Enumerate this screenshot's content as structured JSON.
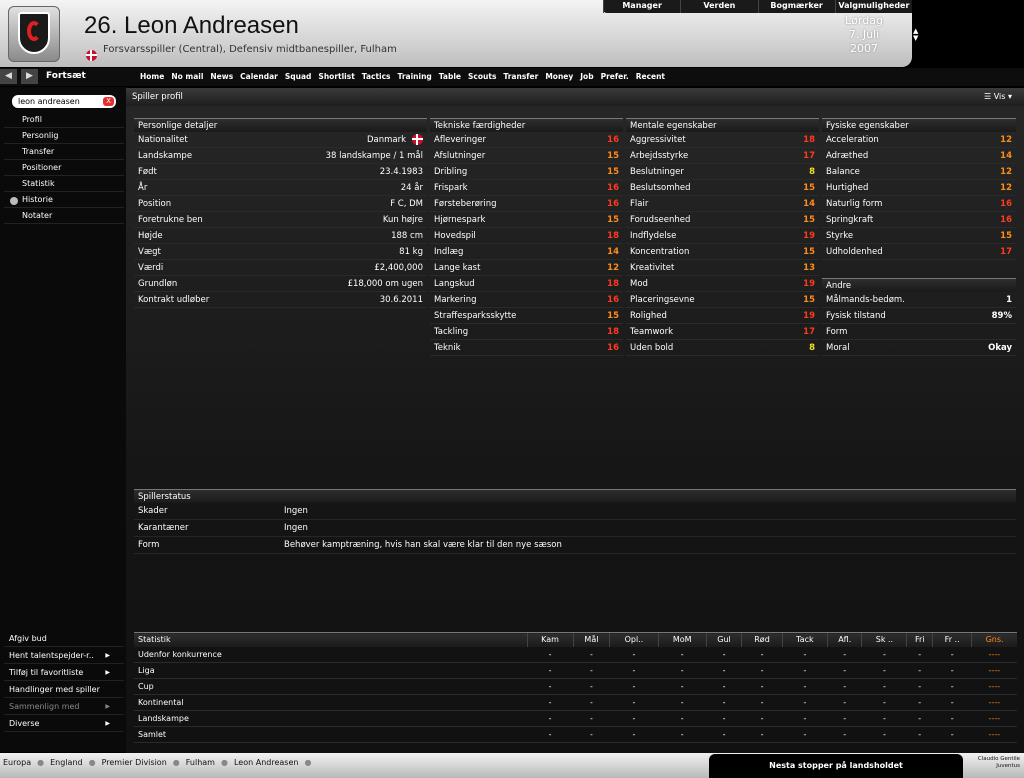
{
  "header": {
    "player_name": "26. Leon Andreasen",
    "player_role": "Forsvarsspiller (Central), Defensiv midtbanespiller, Fulham",
    "top_menu": [
      "Manager",
      "Verden",
      "Bogmærker",
      "Valgmuligheder"
    ],
    "date": {
      "weekday": "Lørdag",
      "day": "7. Juli",
      "year": "2007"
    }
  },
  "nav": {
    "back_label": "Fortsæt",
    "items": [
      "Home",
      "No mail",
      "News",
      "Calendar",
      "Squad",
      "Shortlist",
      "Tactics",
      "Training",
      "Table",
      "Scouts",
      "Transfer",
      "Money",
      "Job",
      "Prefer.",
      "Recent"
    ]
  },
  "sidebar": {
    "search_value": "leon andreasen",
    "search_clear": "X",
    "items": [
      "Profil",
      "Personlig",
      "Transfer",
      "Positioner",
      "Statistik",
      "Historie",
      "Notater"
    ],
    "actions": [
      "Afgiv bud",
      "Hent talentspejder-r..",
      "Tilføj til favoritliste",
      "Handlinger med spiller",
      "Sammenlign med",
      "Diverse"
    ]
  },
  "main": {
    "title": "Spiller profil",
    "view_label": "Vis"
  },
  "personal": {
    "title": "Personlige detaljer",
    "rows": [
      {
        "label": "Nationalitet",
        "value": "Danmark"
      },
      {
        "label": "Landskampe",
        "value": "38 landskampe / 1 mål"
      },
      {
        "label": "Født",
        "value": "23.4.1983"
      },
      {
        "label": "År",
        "value": "24 år"
      },
      {
        "label": "Position",
        "value": "F C, DM"
      },
      {
        "label": "Foretrukne ben",
        "value": "Kun højre"
      },
      {
        "label": "Højde",
        "value": "188 cm"
      },
      {
        "label": "Vægt",
        "value": "81 kg"
      },
      {
        "label": "Værdi",
        "value": "£2,400,000"
      },
      {
        "label": "Grundløn",
        "value": "£18,000 om ugen"
      },
      {
        "label": "Kontrakt udløber",
        "value": "30.6.2011"
      }
    ]
  },
  "technical": {
    "title": "Tekniske færdigheder",
    "rows": [
      {
        "label": "Afleveringer",
        "value": "16",
        "color": "#ff3b1f"
      },
      {
        "label": "Afslutninger",
        "value": "15",
        "color": "#ff8c1a"
      },
      {
        "label": "Dribling",
        "value": "15",
        "color": "#ff8c1a"
      },
      {
        "label": "Frispark",
        "value": "16",
        "color": "#ff3b1f"
      },
      {
        "label": "Førsteberøring",
        "value": "16",
        "color": "#ff3b1f"
      },
      {
        "label": "Hjørnespark",
        "value": "15",
        "color": "#ff8c1a"
      },
      {
        "label": "Hovedspil",
        "value": "18",
        "color": "#ff3b1f"
      },
      {
        "label": "Indlæg",
        "value": "14",
        "color": "#ff8c1a"
      },
      {
        "label": "Lange kast",
        "value": "12",
        "color": "#ff8c1a"
      },
      {
        "label": "Langskud",
        "value": "18",
        "color": "#ff3b1f"
      },
      {
        "label": "Markering",
        "value": "16",
        "color": "#ff3b1f"
      },
      {
        "label": "Straffesparksskytte",
        "value": "15",
        "color": "#ff8c1a"
      },
      {
        "label": "Tackling",
        "value": "18",
        "color": "#ff3b1f"
      },
      {
        "label": "Teknik",
        "value": "16",
        "color": "#ff3b1f"
      }
    ]
  },
  "mental": {
    "title": "Mentale egenskaber",
    "rows": [
      {
        "label": "Aggressivitet",
        "value": "18",
        "color": "#ff3b1f"
      },
      {
        "label": "Arbejdsstyrke",
        "value": "17",
        "color": "#ff3b1f"
      },
      {
        "label": "Beslutninger",
        "value": "8",
        "color": "#f0e020"
      },
      {
        "label": "Beslutsomhed",
        "value": "15",
        "color": "#ff8c1a"
      },
      {
        "label": "Flair",
        "value": "14",
        "color": "#ff8c1a"
      },
      {
        "label": "Forudseenhed",
        "value": "15",
        "color": "#ff8c1a"
      },
      {
        "label": "Indflydelse",
        "value": "19",
        "color": "#ff3b1f"
      },
      {
        "label": "Koncentration",
        "value": "15",
        "color": "#ff8c1a"
      },
      {
        "label": "Kreativitet",
        "value": "13",
        "color": "#ff8c1a"
      },
      {
        "label": "Mod",
        "value": "19",
        "color": "#ff3b1f"
      },
      {
        "label": "Placeringsevne",
        "value": "15",
        "color": "#ff8c1a"
      },
      {
        "label": "Rolighed",
        "value": "19",
        "color": "#ff3b1f"
      },
      {
        "label": "Teamwork",
        "value": "17",
        "color": "#ff3b1f"
      },
      {
        "label": "Uden bold",
        "value": "8",
        "color": "#f0e020"
      }
    ]
  },
  "physical": {
    "title": "Fysiske egenskaber",
    "rows": [
      {
        "label": "Acceleration",
        "value": "12",
        "color": "#ff8c1a"
      },
      {
        "label": "Adræthed",
        "value": "14",
        "color": "#ff8c1a"
      },
      {
        "label": "Balance",
        "value": "12",
        "color": "#ff8c1a"
      },
      {
        "label": "Hurtighed",
        "value": "12",
        "color": "#ff8c1a"
      },
      {
        "label": "Naturlig form",
        "value": "16",
        "color": "#ff3b1f"
      },
      {
        "label": "Springkraft",
        "value": "16",
        "color": "#ff3b1f"
      },
      {
        "label": "Styrke",
        "value": "15",
        "color": "#ff8c1a"
      },
      {
        "label": "Udholdenhed",
        "value": "17",
        "color": "#ff3b1f"
      }
    ]
  },
  "other": {
    "title": "Andre",
    "rows": [
      {
        "label": "Målmands-bedøm.",
        "value": "1"
      },
      {
        "label": "Fysisk tilstand",
        "value": "89%"
      },
      {
        "label": "Form",
        "value": ""
      },
      {
        "label": "Moral",
        "value": "Okay"
      }
    ]
  },
  "status": {
    "title": "Spillerstatus",
    "rows": [
      {
        "label": "Skader",
        "value": "Ingen"
      },
      {
        "label": "Karantæner",
        "value": "Ingen"
      },
      {
        "label": "Form",
        "value": "Behøver kamptræning, hvis han skal være klar til den nye sæson"
      }
    ]
  },
  "stats": {
    "title": "Statistik",
    "columns": [
      "Kam",
      "Mål",
      "Opl..",
      "MoM",
      "Gul",
      "Rød",
      "Tack",
      "Afl.",
      "Sk ..",
      "Fri",
      "Fr ..",
      "Gns."
    ],
    "rows": [
      {
        "label": "Udenfor konkurrence",
        "values": [
          "-",
          "-",
          "-",
          "-",
          "-",
          "-",
          "-",
          "-",
          "-",
          "-",
          "-",
          "----"
        ]
      },
      {
        "label": "Liga",
        "values": [
          "-",
          "-",
          "-",
          "-",
          "-",
          "-",
          "-",
          "-",
          "-",
          "-",
          "-",
          "----"
        ]
      },
      {
        "label": "Cup",
        "values": [
          "-",
          "-",
          "-",
          "-",
          "-",
          "-",
          "-",
          "-",
          "-",
          "-",
          "-",
          "----"
        ]
      },
      {
        "label": "Kontinental",
        "values": [
          "-",
          "-",
          "-",
          "-",
          "-",
          "-",
          "-",
          "-",
          "-",
          "-",
          "-",
          "----"
        ]
      },
      {
        "label": "Landskampe",
        "values": [
          "-",
          "-",
          "-",
          "-",
          "-",
          "-",
          "-",
          "-",
          "-",
          "-",
          "-",
          "----"
        ]
      },
      {
        "label": "Samlet",
        "values": [
          "-",
          "-",
          "-",
          "-",
          "-",
          "-",
          "-",
          "-",
          "-",
          "-",
          "-",
          "----"
        ]
      }
    ]
  },
  "footer": {
    "breadcrumbs": [
      "Europa",
      "England",
      "Premier Division",
      "Fulham",
      "Leon Andreasen"
    ],
    "news": "Nesta stopper på landsholdet",
    "quote_name": "Claudio Gentile",
    "quote_club": "Juventus"
  }
}
